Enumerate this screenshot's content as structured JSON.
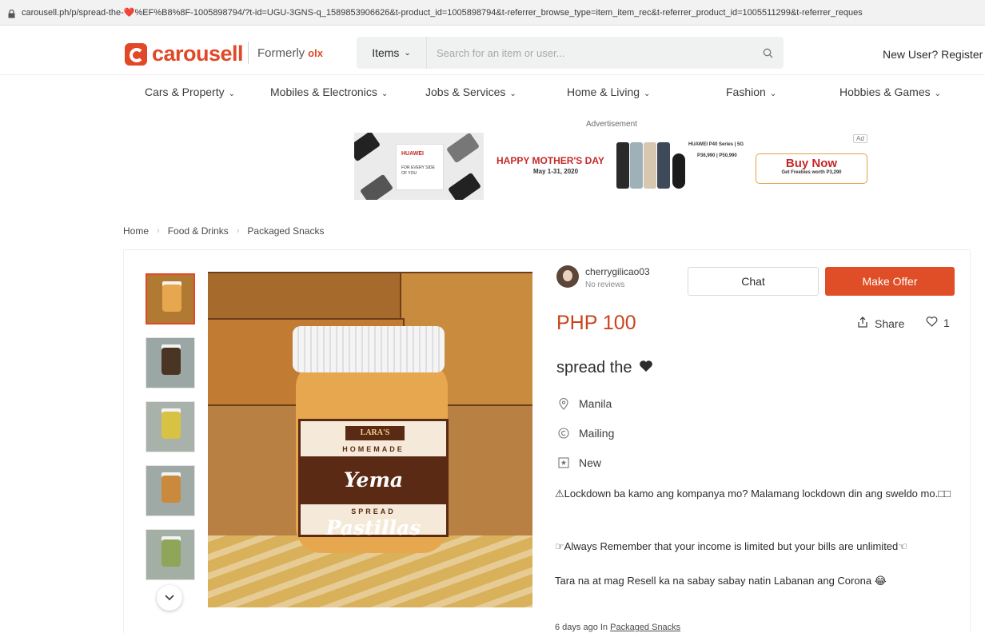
{
  "browser": {
    "url": "carousell.ph/p/spread-the-❤️%EF%B8%8F-1005898794/?t-id=UGU-3GNS-q_1589853906626&t-product_id=1005898794&t-referrer_browse_type=item_item_rec&t-referrer_product_id=1005511299&t-referrer_reques"
  },
  "header": {
    "logo_text": "carousell",
    "formerly_label": "Formerly",
    "formerly_brand": "olx",
    "search_category": "Items",
    "search_placeholder": "Search for an item or user...",
    "register_label": "New User? Register"
  },
  "categories": [
    {
      "label": "Cars & Property"
    },
    {
      "label": "Mobiles & Electronics"
    },
    {
      "label": "Jobs & Services"
    },
    {
      "label": "Home & Living"
    },
    {
      "label": "Fashion"
    },
    {
      "label": "Hobbies & Games"
    }
  ],
  "advertisement": {
    "label": "Advertisement",
    "brand": "HUAWEI",
    "brand_tagline": "FOR EVERY SIDE OF YOU",
    "headline": "HAPPY MOTHER'S DAY",
    "dates": "May 1-31, 2020",
    "product": "HUAWEI P40 Series | 5G",
    "prices": "P36,990 | P50,990",
    "cta_title": "Buy Now",
    "cta_subtitle": "Get Freebies worth P3,290",
    "badge": "Ad"
  },
  "breadcrumb": [
    {
      "label": "Home"
    },
    {
      "label": "Food & Drinks"
    },
    {
      "label": "Packaged Snacks"
    }
  ],
  "product_image": {
    "label_brand": "LARA'S",
    "label_homemade": "HOMEMADE",
    "label_name": "Yema Pastillas",
    "label_spread": "SPREAD"
  },
  "seller": {
    "username": "cherrygilicao03",
    "reviews": "No reviews"
  },
  "actions": {
    "chat_label": "Chat",
    "offer_label": "Make Offer",
    "share_label": "Share",
    "like_count": "1"
  },
  "listing": {
    "price": "PHP 100",
    "title": "spread the",
    "location": "Manila",
    "delivery": "Mailing",
    "condition": "New",
    "description": [
      "⚠Lockdown ba kamo ang kompanya mo? Malamang lockdown din ang sweldo mo.□□",
      "☞Always Remember that your income is limited but your bills are unlimited☜",
      "Tara na at mag Resell ka na sabay sabay natin Labanan ang Corona 😂"
    ],
    "posted_prefix": "6 days ago In",
    "posted_category": "Packaged Snacks"
  },
  "colors": {
    "brand": "#e04827",
    "price": "#c9441d",
    "offer_button": "#df4e26"
  },
  "icons": {
    "lock": "lock-icon",
    "search": "search-icon",
    "chevron": "chevron-down-icon",
    "share": "share-icon",
    "like": "heart-outline-icon",
    "location": "location-pin-icon",
    "delivery": "mailing-icon",
    "condition": "condition-icon"
  }
}
